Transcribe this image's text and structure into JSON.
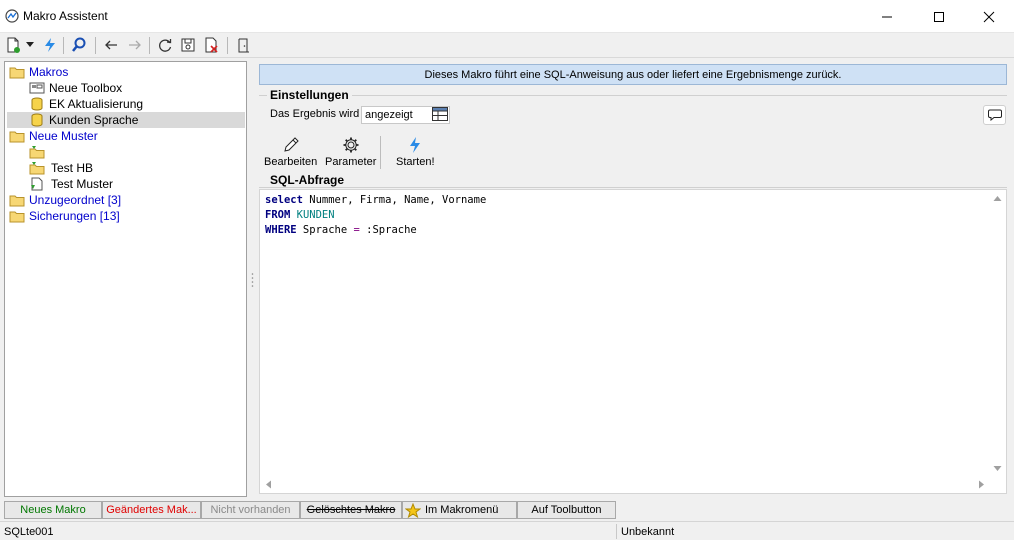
{
  "window": {
    "title": "Makro Assistent"
  },
  "toolbar": {
    "icons": [
      "new-document-icon",
      "dropdown-arrow-icon",
      "lightning-icon",
      "search-icon",
      "arrow-left-icon",
      "arrow-right-icon",
      "refresh-icon",
      "save-icon",
      "delete-document-icon",
      "exit-door-icon"
    ]
  },
  "tree": {
    "items": [
      {
        "label": "Makros",
        "kind": "folder"
      },
      {
        "label": "Neue Toolbox",
        "kind": "toolbox"
      },
      {
        "label": "EK Aktualisierung",
        "kind": "macro"
      },
      {
        "label": "Kunden Sprache",
        "kind": "macro",
        "selected": true
      },
      {
        "label": "Neue Muster",
        "kind": "folder"
      },
      {
        "label": "",
        "kind": "pattern-folder"
      },
      {
        "label": "Test HB",
        "kind": "pattern"
      },
      {
        "label": "Test Muster",
        "kind": "pattern-doc"
      },
      {
        "label": "Unzugeordnet [3]",
        "kind": "folder"
      },
      {
        "label": "Sicherungen [13]",
        "kind": "folder"
      }
    ]
  },
  "info": {
    "text": "Dieses Makro führt eine SQL-Anweisung aus oder liefert eine Ergebnismenge zurück."
  },
  "settings": {
    "title": "Einstellungen",
    "result_label": "Das Ergebnis wird",
    "result_value": "angezeigt",
    "actions": {
      "edit": "Bearbeiten",
      "params": "Parameter",
      "start": "Starten!"
    }
  },
  "sql": {
    "title": "SQL-Abfrage",
    "line1": {
      "kw": "select",
      "rest": " Nummer, Firma, Name, Vorname"
    },
    "line2": {
      "kw": "FROM",
      "table": "KUNDEN"
    },
    "line3": {
      "kw": "WHERE",
      "col": " Sprache ",
      "op": "=",
      "param": " :Sprache"
    }
  },
  "legend": {
    "new": "Neues Makro",
    "changed": "Geändertes Mak...",
    "missing": "Nicht vorhanden",
    "deleted": "Gelöschtes Makro",
    "menu": "Im Makromenü",
    "toolbutton": "Auf Toolbutton",
    "colors": {
      "new": "#007700",
      "changed": "#e00000",
      "missing": "#8a8a8a",
      "deleted": "#000000"
    }
  },
  "status": {
    "left": "SQLte001",
    "right": "Unbekannt"
  }
}
